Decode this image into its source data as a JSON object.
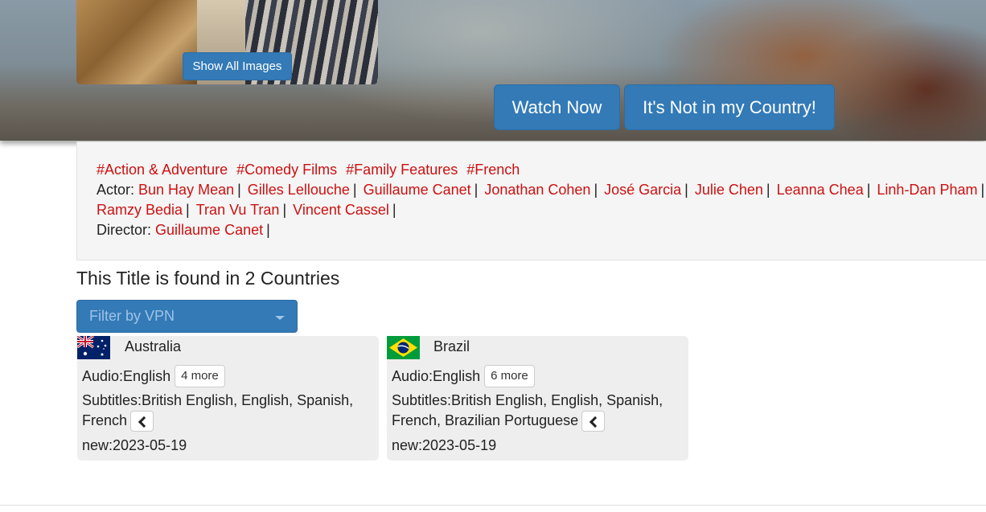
{
  "hero": {
    "show_images_label": "Show All Images",
    "watch_now_label": "Watch Now",
    "not_in_country_label": "It's Not in my Country!"
  },
  "info": {
    "genres": [
      "#Action & Adventure",
      "#Comedy Films",
      "#Family Features",
      "#French"
    ],
    "actor_label": "Actor:",
    "actors_line1": [
      "Bun Hay Mean",
      "Gilles Lellouche",
      "Guillaume Canet",
      "Jonathan Cohen",
      "José Garcia",
      "Julie Chen",
      "Leanna Chea",
      "Linh-Dan Pham"
    ],
    "actors_line2": [
      "Ramzy Bedia",
      "Tran Vu Tran",
      "Vincent Cassel"
    ],
    "director_label": "Director:",
    "directors": [
      "Guillaume Canet"
    ],
    "separator": "|"
  },
  "countries_section": {
    "title": "This Title is found in 2 Countries",
    "filter_placeholder": "Filter by VPN"
  },
  "countries": [
    {
      "name": "Australia",
      "flag_icon": "australia-flag-icon",
      "audio_label": "Audio:English",
      "audio_more": "4 more",
      "subtitles_text": "Subtitles:British English, English, Spanish, French",
      "new_label": "new:2023-05-19"
    },
    {
      "name": "Brazil",
      "flag_icon": "brazil-flag-icon",
      "audio_label": "Audio:English",
      "audio_more": "6 more",
      "subtitles_text": "Subtitles:British English, English, Spanish, French, Brazilian Portuguese",
      "new_label": "new:2023-05-19"
    }
  ],
  "colors": {
    "primary": "#337ab7",
    "link": "#cc1111",
    "panel": "#f5f5f5",
    "card": "#eeeeee"
  }
}
